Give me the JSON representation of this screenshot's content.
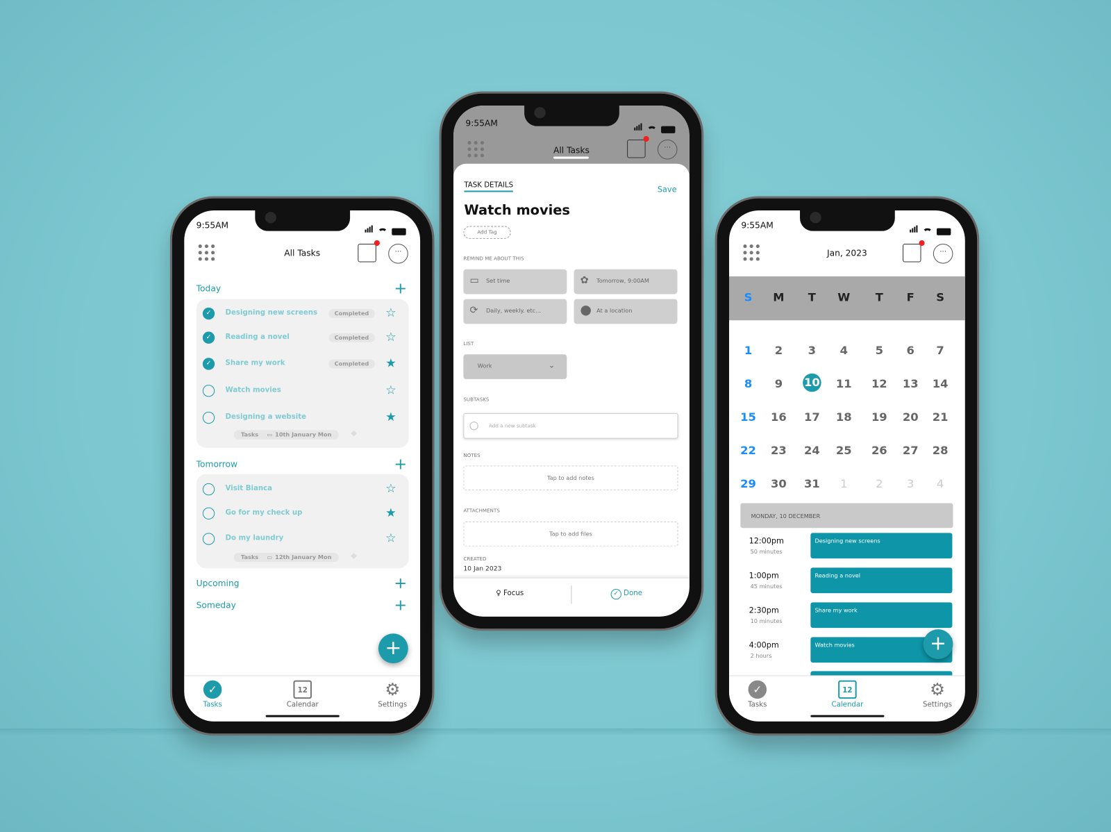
{
  "colors": {
    "accent": "#1d9bab",
    "background": "#7fc9d2",
    "event": "#0e96a8",
    "notification": "#e22222"
  },
  "status_time": "9:55AM",
  "tasks_screen": {
    "title": "All Tasks",
    "sections": [
      {
        "label": "Today",
        "tasks": [
          {
            "title": "Designing new screens",
            "done": true,
            "badge": "Completed",
            "starred": false
          },
          {
            "title": "Reading a novel",
            "done": true,
            "badge": "Completed",
            "starred": false
          },
          {
            "title": "Share my work",
            "done": true,
            "badge": "Completed",
            "starred": true
          },
          {
            "title": "Watch movies",
            "done": false,
            "badge": "",
            "starred": false
          },
          {
            "title": "Designing a website",
            "done": false,
            "badge": "",
            "starred": true
          }
        ],
        "meta": {
          "list": "Tasks",
          "date": "10th January Mon"
        }
      },
      {
        "label": "Tomorrow",
        "tasks": [
          {
            "title": "Visit Bianca",
            "done": false,
            "starred": false
          },
          {
            "title": "Go for my check up",
            "done": false,
            "starred": true
          },
          {
            "title": "Do my laundry",
            "done": false,
            "starred": false
          }
        ],
        "meta": {
          "list": "Tasks",
          "date": "12th January Mon"
        }
      },
      {
        "label": "Upcoming"
      },
      {
        "label": "Someday"
      }
    ]
  },
  "nav": {
    "tasks": "Tasks",
    "calendar": "Calendar",
    "settings": "Settings",
    "calendar_day": "12"
  },
  "detail_screen": {
    "header_title": "All Tasks",
    "tab": "TASK DETAILS",
    "save": "Save",
    "title": "Watch movies",
    "add_tag": "Add Tag",
    "remind_label": "REMIND ME ABOUT THIS",
    "remind": {
      "set_time": "Set time",
      "tomorrow": "Tomorrow, 9:00AM",
      "repeat": "Daily, weekly. etc...",
      "location": "At a location"
    },
    "list_label": "LIST",
    "list_value": "Work",
    "subtasks_label": "SUBTASKS",
    "subtask_placeholder": "Add a new subtask",
    "notes_label": "NOTES",
    "notes_placeholder": "Tap to add notes",
    "attachments_label": "ATTACHMENTS",
    "attachments_placeholder": "Tap to add files",
    "created_label": "CREATED",
    "created_value": "10 Jan 2023",
    "focus": "Focus",
    "done": "Done"
  },
  "calendar_screen": {
    "title": "Jan, 2023",
    "weekdays": [
      "S",
      "M",
      "T",
      "W",
      "T",
      "F",
      "S"
    ],
    "weeks": [
      [
        "1",
        "2",
        "3",
        "4",
        "5",
        "6",
        "7"
      ],
      [
        "8",
        "9",
        "10",
        "11",
        "12",
        "13",
        "14"
      ],
      [
        "15",
        "16",
        "17",
        "18",
        "19",
        "20",
        "21"
      ],
      [
        "22",
        "23",
        "24",
        "25",
        "26",
        "27",
        "28"
      ],
      [
        "29",
        "30",
        "31",
        "1",
        "2",
        "3",
        "4"
      ]
    ],
    "selected": "10",
    "day_header": "MONDAY, 10 DECEMBER",
    "events": [
      {
        "time": "12:00pm",
        "duration": "50 minutes",
        "title": "Designing new screens"
      },
      {
        "time": "1:00pm",
        "duration": "45 minutes",
        "title": "Reading a novel"
      },
      {
        "time": "2:30pm",
        "duration": "10 minutes",
        "title": "Share my work"
      },
      {
        "time": "4:00pm",
        "duration": "2 hours",
        "title": "Watch movies"
      }
    ]
  }
}
